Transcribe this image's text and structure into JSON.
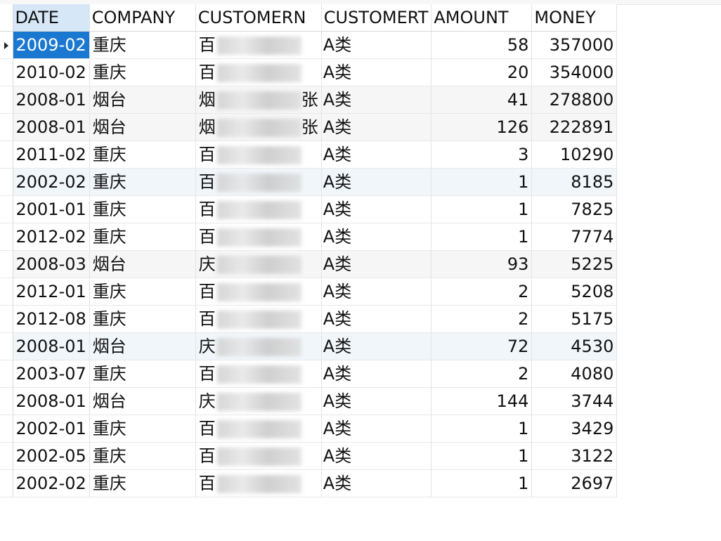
{
  "columns": [
    "DATE",
    "COMPANY",
    "CUSTOMERN",
    "CUSTOMERT",
    "AMOUNT",
    "MONEY"
  ],
  "rows": [
    {
      "date": "2009-02",
      "company": "重庆",
      "customer_first": "百",
      "customer_tail": "",
      "type": "A类",
      "amount": "58",
      "money": "357000"
    },
    {
      "date": "2010-02",
      "company": "重庆",
      "customer_first": "百",
      "customer_tail": "",
      "type": "A类",
      "amount": "20",
      "money": "354000"
    },
    {
      "date": "2008-01",
      "company": "烟台",
      "customer_first": "烟",
      "customer_tail": "张",
      "type": "A类",
      "amount": "41",
      "money": "278800"
    },
    {
      "date": "2008-01",
      "company": "烟台",
      "customer_first": "烟",
      "customer_tail": "张",
      "type": "A类",
      "amount": "126",
      "money": "222891"
    },
    {
      "date": "2011-02",
      "company": "重庆",
      "customer_first": "百",
      "customer_tail": "",
      "type": "A类",
      "amount": "3",
      "money": "10290"
    },
    {
      "date": "2002-02",
      "company": "重庆",
      "customer_first": "百",
      "customer_tail": "",
      "type": "A类",
      "amount": "1",
      "money": "8185"
    },
    {
      "date": "2001-01",
      "company": "重庆",
      "customer_first": "百",
      "customer_tail": "",
      "type": "A类",
      "amount": "1",
      "money": "7825"
    },
    {
      "date": "2012-02",
      "company": "重庆",
      "customer_first": "百",
      "customer_tail": "",
      "type": "A类",
      "amount": "1",
      "money": "7774"
    },
    {
      "date": "2008-03",
      "company": "烟台",
      "customer_first": "庆",
      "customer_tail": "",
      "type": "A类",
      "amount": "93",
      "money": "5225"
    },
    {
      "date": "2012-01",
      "company": "重庆",
      "customer_first": "百",
      "customer_tail": "",
      "type": "A类",
      "amount": "2",
      "money": "5208"
    },
    {
      "date": "2012-08",
      "company": "重庆",
      "customer_first": "百",
      "customer_tail": "",
      "type": "A类",
      "amount": "2",
      "money": "5175"
    },
    {
      "date": "2008-01",
      "company": "烟台",
      "customer_first": "庆",
      "customer_tail": "",
      "type": "A类",
      "amount": "72",
      "money": "4530"
    },
    {
      "date": "2003-07",
      "company": "重庆",
      "customer_first": "百",
      "customer_tail": "",
      "type": "A类",
      "amount": "2",
      "money": "4080"
    },
    {
      "date": "2008-01",
      "company": "烟台",
      "customer_first": "庆",
      "customer_tail": "",
      "type": "A类",
      "amount": "144",
      "money": "3744"
    },
    {
      "date": "2002-01",
      "company": "重庆",
      "customer_first": "百",
      "customer_tail": "",
      "type": "A类",
      "amount": "1",
      "money": "3429"
    },
    {
      "date": "2002-05",
      "company": "重庆",
      "customer_first": "百",
      "customer_tail": "",
      "type": "A类",
      "amount": "1",
      "money": "3122"
    },
    {
      "date": "2002-02",
      "company": "重庆",
      "customer_first": "百",
      "customer_tail": "",
      "type": "A类",
      "amount": "1",
      "money": "2697"
    }
  ],
  "selection": {
    "row": 0,
    "column": "DATE"
  },
  "colors": {
    "selected_bg": "#1b78d0",
    "sorted_header_bg": "#d6e7f7"
  }
}
